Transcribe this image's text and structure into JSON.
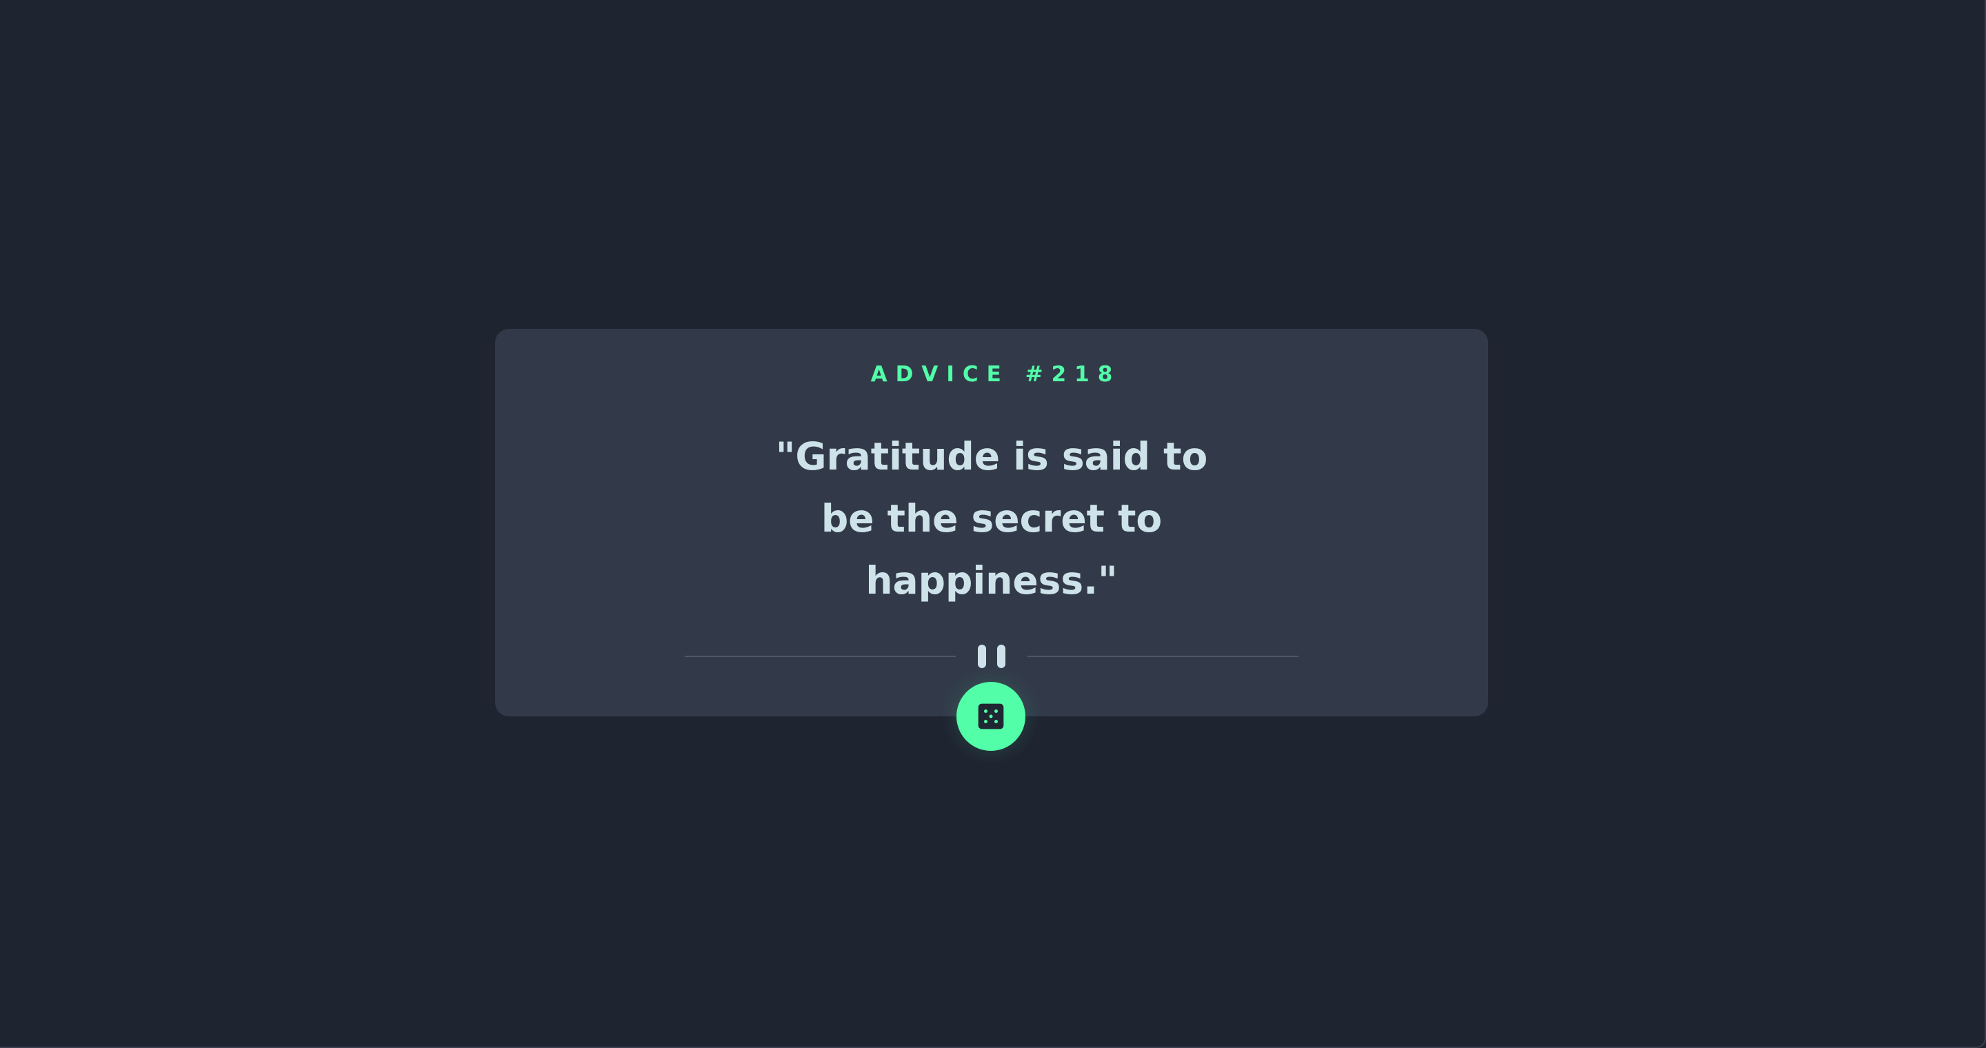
{
  "advice": {
    "id_label": "ADVICE #218",
    "text": "\"Gratitude is said to be the secret to happiness.\""
  },
  "icons": {
    "divider": "pause-icon",
    "button": "dice-icon"
  },
  "colors": {
    "background": "#1f2431",
    "card": "#323a49",
    "accent": "#52ffa8",
    "text": "#cee3e9"
  }
}
